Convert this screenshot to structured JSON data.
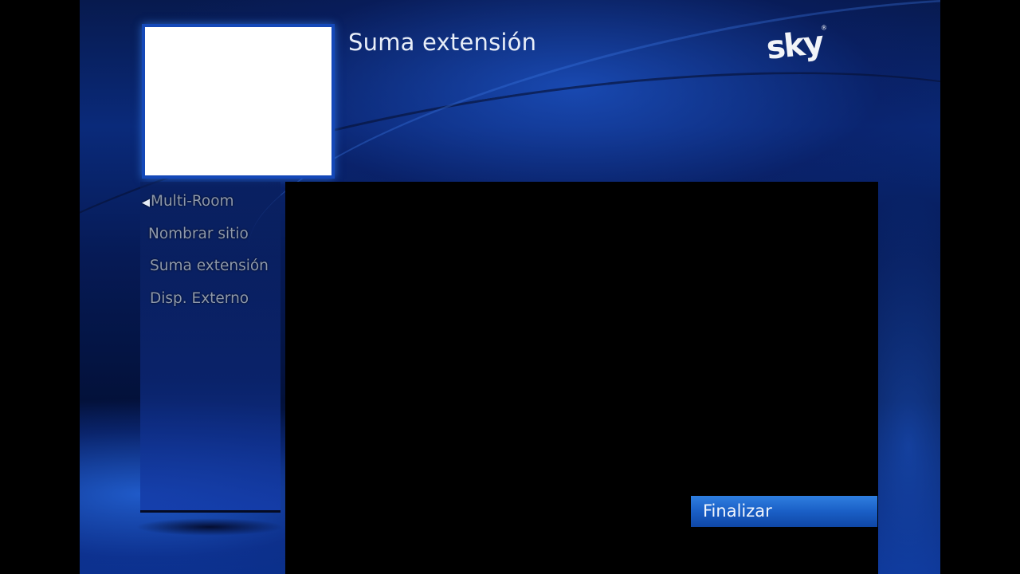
{
  "header": {
    "title": "Suma extensión",
    "logo_text": "sky",
    "logo_mark": "®"
  },
  "menu": {
    "back_icon": "chevron-left-icon",
    "items": [
      {
        "label": "Multi-Room"
      },
      {
        "label": "Nombrar sitio"
      },
      {
        "label": "Suma extensión"
      },
      {
        "label": "Disp. Externo"
      }
    ]
  },
  "actions": {
    "finish_label": "Finalizar"
  },
  "colors": {
    "accent": "#1a5fc6",
    "background": "#0a2a7a",
    "thumbnail_border": "#1448b8"
  }
}
